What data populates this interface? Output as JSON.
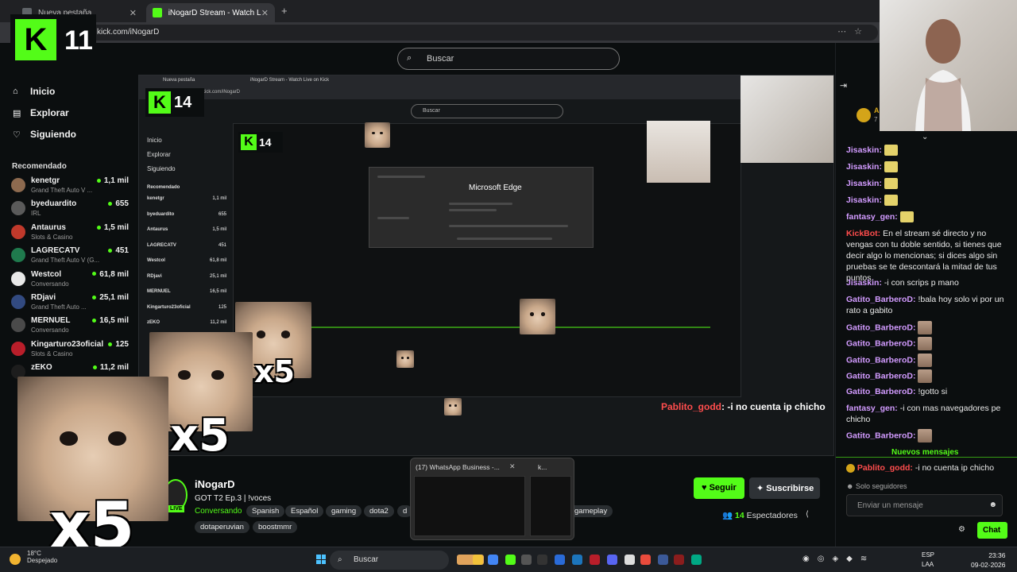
{
  "browser": {
    "tabs": [
      {
        "label": "Nueva pestaña"
      },
      {
        "label": "iNogarD Stream - Watch Live on Kick"
      }
    ],
    "url": "kick.com/iNogarD"
  },
  "header": {
    "search_placeholder": "Buscar"
  },
  "logo": {
    "letter": "K",
    "number": "11"
  },
  "sidebar": {
    "nav": [
      {
        "label": "Inicio"
      },
      {
        "label": "Explorar"
      },
      {
        "label": "Siguiendo"
      }
    ],
    "recommended_title": "Recomendado",
    "recommended": [
      {
        "name": "kenetgr",
        "category": "Grand Theft Auto V ...",
        "viewers": "1,1 mil",
        "color": "#8d6a4f"
      },
      {
        "name": "byeduardito",
        "category": "IRL",
        "viewers": "655",
        "color": "#5a5a5a"
      },
      {
        "name": "Antaurus",
        "category": "Slots & Casino",
        "viewers": "1,5 mil",
        "color": "#c0392b"
      },
      {
        "name": "LAGRECATV",
        "category": "Grand Theft Auto V (G...",
        "viewers": "451",
        "color": "#1f7a4d"
      },
      {
        "name": "Westcol",
        "category": "Conversando",
        "viewers": "61,8 mil",
        "color": "#e8e8e8"
      },
      {
        "name": "RDjavi",
        "category": "Grand Theft Auto ...",
        "viewers": "25,1 mil",
        "color": "#324a80"
      },
      {
        "name": "MERNUEL",
        "category": "Conversando",
        "viewers": "16,5 mil",
        "color": "#4a4a4a"
      },
      {
        "name": "Kingarturo23oficial",
        "category": "Slots & Casino",
        "viewers": "125",
        "color": "#b91e2a"
      },
      {
        "name": "zEKO",
        "category": "",
        "viewers": "11,2 mil",
        "color": "#1d1d1d"
      }
    ]
  },
  "nested": {
    "logo_number": "14",
    "logo_number_inner": "14",
    "edge_title": "Microsoft Edge",
    "search": "Buscar"
  },
  "stream": {
    "name": "iNogarD",
    "title": "GOT T2 Ep.3 | !voces",
    "category": "Conversando",
    "tags": [
      "Spanish",
      "Español",
      "gaming",
      "dota2",
      "d",
      "gameplay",
      "dotaperuvian",
      "boostmmr"
    ],
    "live_label": "LIVE",
    "follow_label": "Seguir",
    "subscribe_label": "Suscribirse",
    "viewers_count": "14",
    "viewers_label": "Espectadores"
  },
  "popup": {
    "title1": "(17) WhatsApp Business -...",
    "title2": "k..."
  },
  "chat": {
    "top_badge": "A",
    "top_badge_sub": "7",
    "messages": [
      {
        "user": "Jisaskin:",
        "text": "",
        "emote": "cat",
        "color": "#d29bff"
      },
      {
        "user": "Jisaskin:",
        "text": "",
        "emote": "cat",
        "color": "#d29bff"
      },
      {
        "user": "Jisaskin:",
        "text": "",
        "emote": "cat",
        "color": "#d29bff"
      },
      {
        "user": "Jisaskin:",
        "text": "",
        "emote": "cat",
        "color": "#d29bff"
      },
      {
        "user": "fantasy_gen:",
        "text": "",
        "emote": "cat",
        "color": "#d29bff"
      },
      {
        "user": "KickBot:",
        "text": "En el stream sé directo y no vengas con tu doble sentido, si tienes que decir algo lo mencionas; si dices algo sin pruebas se te descontará la mitad de tus puntos.",
        "emote": "",
        "color": "#ff4d4d"
      },
      {
        "user": "Jisaskin:",
        "text": "-i con scrips p mano",
        "emote": "",
        "color": "#d29bff"
      },
      {
        "user": "Gatito_BarberoD:",
        "text": "!bala hoy solo vi por un rato a gabito",
        "emote": "",
        "color": "#d29bff"
      },
      {
        "user": "Gatito_BarberoD:",
        "text": "",
        "emote": "brown",
        "color": "#d29bff"
      },
      {
        "user": "Gatito_BarberoD:",
        "text": "",
        "emote": "brown",
        "color": "#d29bff"
      },
      {
        "user": "Gatito_BarberoD:",
        "text": "",
        "emote": "brown",
        "color": "#d29bff"
      },
      {
        "user": "Gatito_BarberoD:",
        "text": "",
        "emote": "brown",
        "color": "#d29bff"
      },
      {
        "user": "Gatito_BarberoD:",
        "text": "!gotto si",
        "emote": "",
        "color": "#d29bff"
      },
      {
        "user": "fantasy_gen:",
        "text": "-i con mas navegadores pe chicho",
        "emote": "",
        "color": "#d29bff"
      },
      {
        "user": "Gatito_BarberoD:",
        "text": "",
        "emote": "brown",
        "color": "#d29bff"
      }
    ],
    "new_messages": "Nuevos mensajes",
    "pinned": {
      "user": "Pablito_godd:",
      "text": "-i no cuenta ip chicho"
    },
    "followers_only": "Solo seguidores",
    "input_placeholder": "Enviar un mensaje",
    "send_label": "Chat"
  },
  "overlay": {
    "x5": "x5",
    "pinned_overlay": ": -i no cuenta ip chicho",
    "pinned_overlay_user": "Pablito_godd"
  },
  "taskbar": {
    "weather_temp": "18°C",
    "weather_desc": "Despejado",
    "search": "Buscar",
    "lang1": "ESP",
    "lang2": "LAA",
    "time": "23:36",
    "date": "09-02-2026"
  }
}
